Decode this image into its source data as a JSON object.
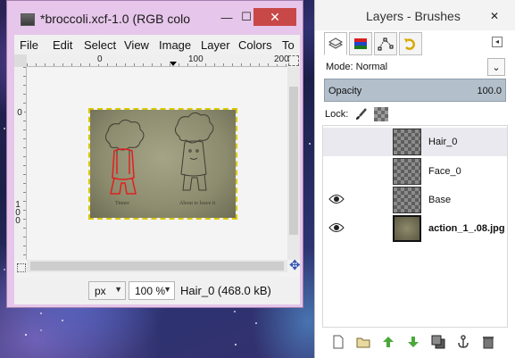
{
  "image_window": {
    "title": "*broccoli.xcf-1.0 (RGB colo",
    "minimize_glyph": "—",
    "maximize_glyph": "☐",
    "close_glyph": "✕",
    "menu": [
      "File",
      "Edit",
      "Select",
      "View",
      "Image",
      "Layer",
      "Colors",
      "To"
    ],
    "ruler_h_labels": [
      "0",
      "100",
      "200"
    ],
    "ruler_v_labels": [
      "0",
      "100"
    ],
    "unit": "px",
    "zoom": "100 %",
    "status": "Hair_0 (468.0 kB)"
  },
  "layers_window": {
    "title": "Layers - Brushes",
    "close_glyph": "✕",
    "tabs": [
      "layers-icon",
      "channels-icon",
      "paths-icon",
      "undo-history-icon"
    ],
    "mode_label": "Mode:",
    "mode_value": "Normal",
    "opacity_label": "Opacity",
    "opacity_value": "100.0",
    "lock_label": "Lock:",
    "layers": [
      {
        "name": "Hair_0",
        "visible": false,
        "selected": true,
        "thumb": "transparent",
        "bold": false
      },
      {
        "name": "Face_0",
        "visible": false,
        "selected": false,
        "thumb": "transparent",
        "bold": false
      },
      {
        "name": "Base",
        "visible": true,
        "selected": false,
        "thumb": "transparent",
        "bold": false
      },
      {
        "name": "action_1_.08.jpg",
        "visible": true,
        "selected": false,
        "thumb": "photo",
        "bold": true
      }
    ],
    "toolbar_icons": [
      "new-layer-icon",
      "new-layer-group-icon",
      "raise-layer-icon",
      "lower-layer-icon",
      "duplicate-layer-icon",
      "anchor-layer-icon",
      "delete-layer-icon"
    ]
  },
  "colors": {
    "image_window_frame": "#e6c6ea",
    "close_button": "#c84848",
    "opacity_bar": "#b3c0cc",
    "selection_outline": "#d9c800",
    "sketch_highlight": "#e02020"
  }
}
